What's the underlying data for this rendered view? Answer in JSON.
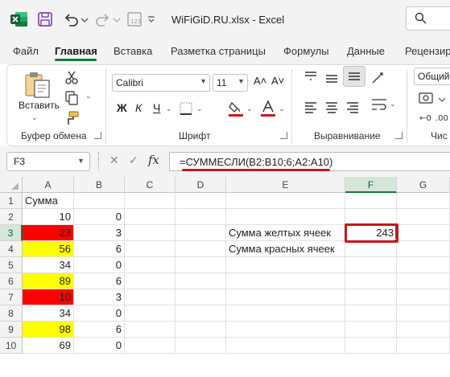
{
  "titlebar": {
    "title": "WiFiGiD.RU.xlsx  -  Excel",
    "search_glyph": "⚲"
  },
  "tabs": [
    "Файл",
    "Главная",
    "Вставка",
    "Разметка страницы",
    "Формулы",
    "Данные",
    "Рецензир"
  ],
  "active_tab": "Главная",
  "ribbon": {
    "clipboard": {
      "paste_label": "Вставить",
      "group_label": "Буфер обмена"
    },
    "font": {
      "family": "Calibri",
      "size": "11",
      "grow": "A˄",
      "shrink": "A˅",
      "bold": "Ж",
      "italic": "К",
      "underline": "Ч",
      "group_label": "Шрифт"
    },
    "alignment": {
      "group_label": "Выравнивание"
    },
    "number": {
      "format": "Общий",
      "group_label": "Чис"
    }
  },
  "formula_bar": {
    "cell_ref": "F3",
    "cancel": "✕",
    "enter": "✓",
    "fx": "fx",
    "formula": "=СУММЕСЛИ(B2:B10;6;A2:A10)"
  },
  "columns": [
    "A",
    "B",
    "C",
    "D",
    "E",
    "F",
    "G"
  ],
  "selected_column": "F",
  "rows": [
    {
      "n": "1",
      "a": "Сумма",
      "b": "",
      "e": "",
      "f": "",
      "fill": ""
    },
    {
      "n": "2",
      "a": "10",
      "b": "0",
      "e": "",
      "f": "",
      "fill": ""
    },
    {
      "n": "3",
      "a": "23",
      "b": "3",
      "e": "Сумма желтых ячеек",
      "f": "243",
      "fill": "red"
    },
    {
      "n": "4",
      "a": "56",
      "b": "6",
      "e": "Сумма красных ячеек",
      "f": "",
      "fill": "yellow"
    },
    {
      "n": "5",
      "a": "34",
      "b": "0",
      "e": "",
      "f": "",
      "fill": ""
    },
    {
      "n": "6",
      "a": "89",
      "b": "6",
      "e": "",
      "f": "",
      "fill": "yellow"
    },
    {
      "n": "7",
      "a": "10",
      "b": "3",
      "e": "",
      "f": "",
      "fill": "red"
    },
    {
      "n": "8",
      "a": "34",
      "b": "0",
      "e": "",
      "f": "",
      "fill": ""
    },
    {
      "n": "9",
      "a": "98",
      "b": "6",
      "e": "",
      "f": "",
      "fill": "yellow"
    },
    {
      "n": "10",
      "a": "69",
      "b": "0",
      "e": "",
      "f": "",
      "fill": ""
    }
  ],
  "selected_row": "3",
  "colors": {
    "accent": "#127a3c",
    "highlight_red": "#ff0000",
    "highlight_yellow": "#ffff00",
    "annotation": "#c8151b"
  }
}
